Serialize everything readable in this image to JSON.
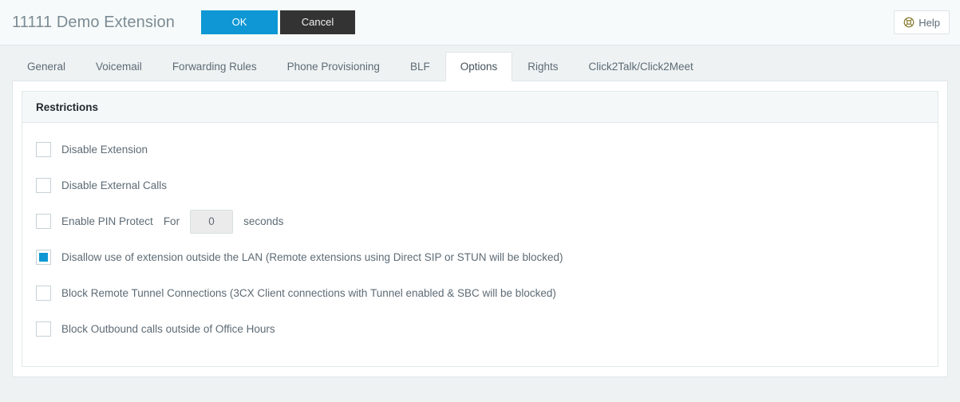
{
  "header": {
    "title": "11111 Demo Extension",
    "ok_label": "OK",
    "cancel_label": "Cancel",
    "help_label": "Help",
    "help_icon": "lifebuoy-icon",
    "accent_color": "#0e97d4",
    "cancel_color": "#333333"
  },
  "tabs": [
    {
      "label": "General",
      "active": false
    },
    {
      "label": "Voicemail",
      "active": false
    },
    {
      "label": "Forwarding Rules",
      "active": false
    },
    {
      "label": "Phone Provisioning",
      "active": false
    },
    {
      "label": "BLF",
      "active": false
    },
    {
      "label": "Options",
      "active": true
    },
    {
      "label": "Rights",
      "active": false
    },
    {
      "label": "Click2Talk/Click2Meet",
      "active": false
    }
  ],
  "restrictions": {
    "panel_title": "Restrictions",
    "options": [
      {
        "label": "Disable Extension",
        "checked": false
      },
      {
        "label": "Disable External Calls",
        "checked": false
      },
      {
        "label": "Enable PIN Protect",
        "checked": false,
        "for_label": "For",
        "pin_value": "0",
        "pin_placeholder": "0",
        "seconds_label": "seconds"
      },
      {
        "label": "Disallow use of extension outside the LAN (Remote extensions using Direct SIP or STUN will be blocked)",
        "checked": true
      },
      {
        "label": "Block Remote Tunnel Connections (3CX Client connections with Tunnel enabled & SBC will be blocked)",
        "checked": false
      },
      {
        "label": "Block Outbound calls outside of Office Hours",
        "checked": false
      }
    ]
  }
}
